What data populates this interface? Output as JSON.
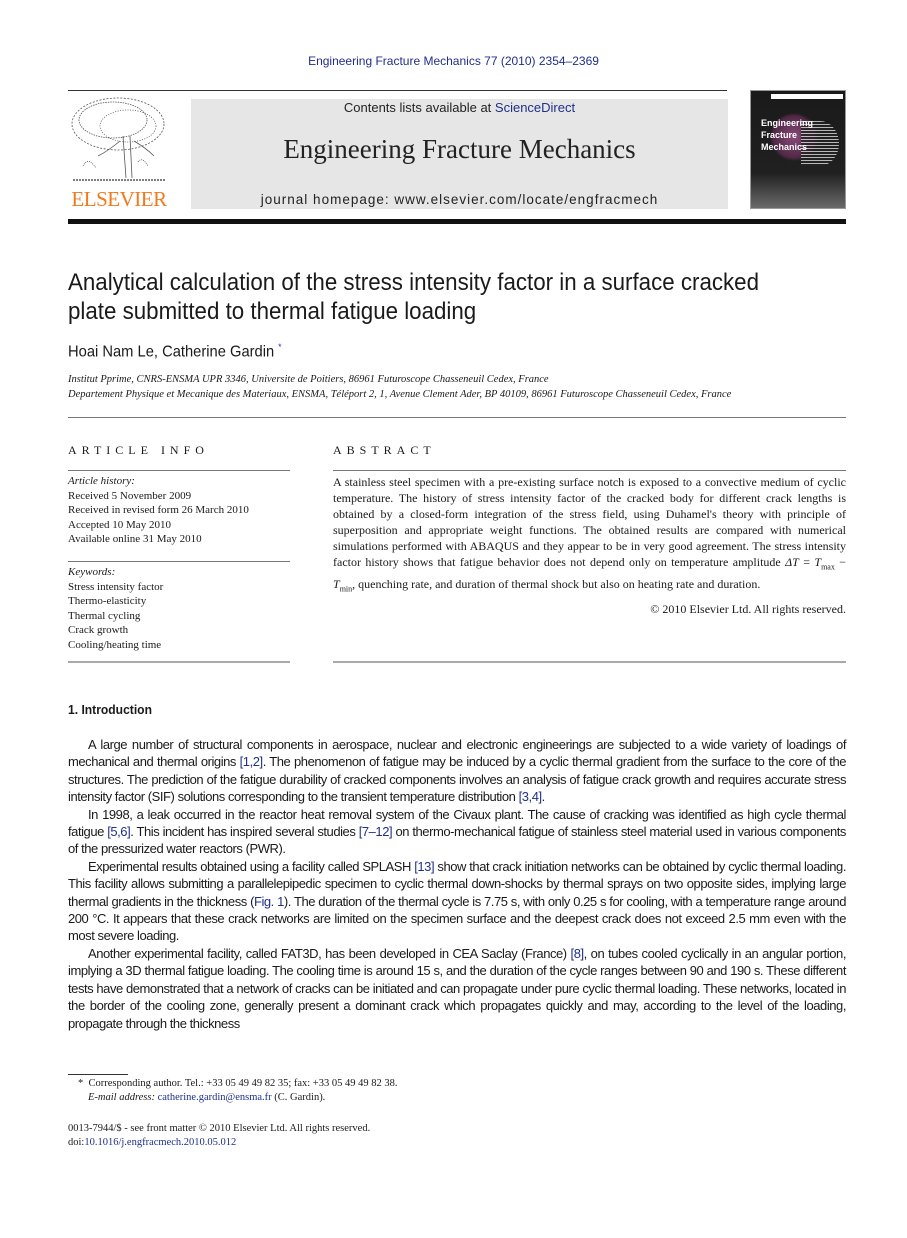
{
  "journal_ref": "Engineering Fracture Mechanics 77 (2010) 2354–2369",
  "masthead": {
    "publisher_logo_text": "ELSEVIER",
    "contents_prefix": "Contents lists available at ",
    "contents_link": "ScienceDirect",
    "journal_title": "Engineering Fracture Mechanics",
    "homepage": "journal homepage: www.elsevier.com/locate/engfracmech",
    "cover_title_line1": "Engineering",
    "cover_title_line2": "Fracture Mechanics",
    "colors": {
      "elsevier_orange": "#f07a1e",
      "link_blue": "#1f2f8a",
      "masthead_gray": "#e6e6e6"
    }
  },
  "article": {
    "title": "Analytical calculation of the stress intensity factor in a surface cracked plate submitted to thermal fatigue loading",
    "authors": "Hoai Nam Le, Catherine Gardin",
    "author_mark": "*",
    "affiliations": [
      "Institut Pprime, CNRS-ENSMA UPR 3346, Universite de Poitiers, 86961 Futuroscope Chasseneuil Cedex, France",
      "Departement Physique et Mecanique des Materiaux, ENSMA, Téléport 2, 1, Avenue Clement Ader, BP 40109, 86961 Futuroscope Chasseneuil Cedex, France"
    ]
  },
  "article_info": {
    "label": "ARTICLE INFO",
    "history_label": "Article history:",
    "history": [
      "Received 5 November 2009",
      "Received in revised form 26 March 2010",
      "Accepted 10 May 2010",
      "Available online 31 May 2010"
    ],
    "keywords_label": "Keywords:",
    "keywords": [
      "Stress intensity factor",
      "Thermo-elasticity",
      "Thermal cycling",
      "Crack growth",
      "Cooling/heating time"
    ]
  },
  "abstract": {
    "label": "ABSTRACT",
    "text_main": "A stainless steel specimen with a pre-existing surface notch is exposed to a convective medium of cyclic temperature. The history of stress intensity factor of the cracked body for different crack lengths is obtained by a closed-form integration of the stress field, using Duhamel's theory with principle of superposition and appropriate weight functions. The obtained results are compared with numerical simulations performed with ABAQUS and they appear to be in very good agreement. The stress intensity factor history shows that fatigue behavior does not depend only on temperature amplitude ",
    "formula_delta": "ΔT",
    "formula_eq": " = ",
    "formula_t1": "T",
    "formula_sub1": "max",
    "formula_minus": " − ",
    "formula_t2": "T",
    "formula_sub2": "min",
    "text_end": ", quenching rate, and duration of thermal shock but also on heating rate and duration.",
    "copyright": "© 2010 Elsevier Ltd. All rights reserved."
  },
  "introduction": {
    "heading": "1. Introduction",
    "p1": {
      "a": "A large number of structural components in aerospace, nuclear and electronic engineerings are subjected to a wide variety of loadings of mechanical and thermal origins ",
      "ref1": "[1,2]",
      "b": ". The phenomenon of fatigue may be induced by a cyclic thermal gradient from the surface to the core of the structures. The prediction of the fatigue durability of cracked components involves an analysis of fatigue crack growth and requires accurate stress intensity factor (SIF) solutions corresponding to the transient temperature distribution ",
      "ref2": "[3,4]",
      "c": "."
    },
    "p2": {
      "a": "In 1998, a leak occurred in the reactor heat removal system of the Civaux plant. The cause of cracking was identified as high cycle thermal fatigue ",
      "ref1": "[5,6]",
      "b": ". This incident has inspired several studies ",
      "ref2": "[7–12]",
      "c": " on thermo-mechanical fatigue of stainless steel material used in various components of the pressurized water reactors (PWR)."
    },
    "p3": {
      "a": "Experimental results obtained using a facility called SPLASH ",
      "ref1": "[13]",
      "b": " show that crack initiation networks can be obtained by cyclic thermal loading. This facility allows submitting a parallelepipedic specimen to cyclic thermal down-shocks by thermal sprays on two opposite sides, implying large thermal gradients in the thickness (",
      "ref2": "Fig. 1",
      "c": "). The duration of the thermal cycle is 7.75 s, with only 0.25 s for cooling, with a temperature range around 200 °C. It appears that these crack networks are limited on the specimen surface and the deepest crack does not exceed 2.5 mm even with the most severe loading."
    },
    "p4": {
      "a": "Another experimental facility, called FAT3D, has been developed in CEA Saclay (France) ",
      "ref1": "[8]",
      "b": ", on tubes cooled cyclically in an angular portion, implying a 3D thermal fatigue loading. The cooling time is around 15 s, and the duration of the cycle ranges between 90 and 190 s. These different tests have demonstrated that a network of cracks can be initiated and can propagate under pure cyclic thermal loading. These networks, located in the border of the cooling zone, generally present a dominant crack which propagates quickly and may, according to the level of the loading, propagate through the thickness"
    }
  },
  "footnotes": {
    "corr_mark": "*",
    "corresponding": "Corresponding author. Tel.: +33 05 49 49 82 35; fax: +33 05 49 49 82 38.",
    "email_label": "E-mail address:",
    "email": "catherine.gardin@ensma.fr",
    "email_suffix": " (C. Gardin).",
    "issn": "0013-7944/$ - see front matter © 2010 Elsevier Ltd. All rights reserved.",
    "doi_prefix": "doi:",
    "doi": "10.1016/j.engfracmech.2010.05.012"
  }
}
